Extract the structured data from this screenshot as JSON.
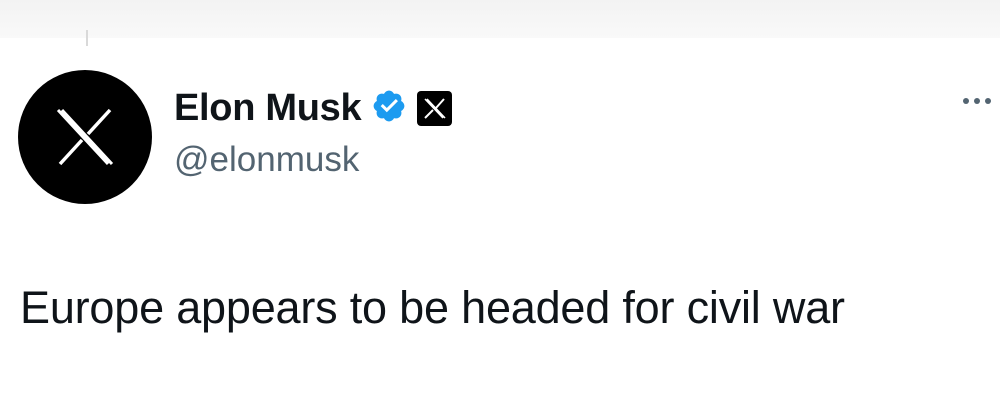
{
  "tweet": {
    "author": {
      "display_name": "Elon Musk",
      "handle": "@elonmusk",
      "avatar_icon": "x-logo-icon",
      "verified_icon": "verified-badge-icon",
      "affiliate_icon": "x-affiliate-badge-icon"
    },
    "text": "Europe appears to be headed for civil war",
    "more_icon": "more-options-icon"
  },
  "colors": {
    "text_primary": "#0f1419",
    "text_secondary": "#536471",
    "verified": "#1d9bf0",
    "avatar_bg": "#000000"
  }
}
